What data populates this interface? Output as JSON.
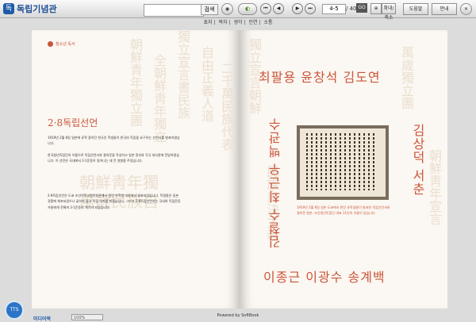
{
  "app": {
    "logo_text": "독립기념관",
    "logo_mark": "독"
  },
  "toolbar": {
    "search_placeholder": "",
    "search_button": "검색",
    "page_current": "4-5",
    "page_total": "/ 40",
    "go_label": "GO",
    "small_label": "확대/축소",
    "library_button": "도움말",
    "guide_button": "안내"
  },
  "subnav": [
    "표지",
    "목차",
    "생각",
    "인연",
    "소통"
  ],
  "left_page": {
    "tag": "청소년 독서",
    "title": "2·8독립선언",
    "paragraphs": [
      "1919년 2월 8일 일본에 유학 중이던 한국인 학생들이 한국의 독립을 요구하는 선언서를 발표하였습니다.",
      "한국청년독립단의 이름으로 독립선언서와 결의문을 작성하고 일본 정부와 각국 대사관에 전달하였습니다. 이 선언은 국내에서 3·1운동이 일어나는 데 큰 영향을 주었습니다.",
      "2·8독립선언은 도쿄 조선기독교청년회관에서 열린 유학생 대회에서 발표되었습니다. 학생들은 일본 경찰에 체포되었으나 굴하지 않고 독립 의지를 밝혔습니다. 그리고 2·8독립선언서는 국내외 독립운동가들에게 전해져 3·1운동의 계기가 되었습니다."
    ]
  },
  "right_page": {
    "names_top": "최팔용 윤창석 김도연",
    "names_bottom": "이종근 이광수 송계백",
    "names_left": "김철수 최근우 백관수",
    "names_right": "김상덕 서춘",
    "caption": "1919년 2월 8일 일본 도쿄에서 한인 유학생들이 발표한 독립선언서와 결의문 원본. 조선청년독립단 대표 11인의 이름이 있습니다."
  },
  "bottom": {
    "tts_label": "TTS",
    "brand": "미디어북",
    "zoom_value": "100%",
    "powered": "Powered by SoftBook"
  }
}
